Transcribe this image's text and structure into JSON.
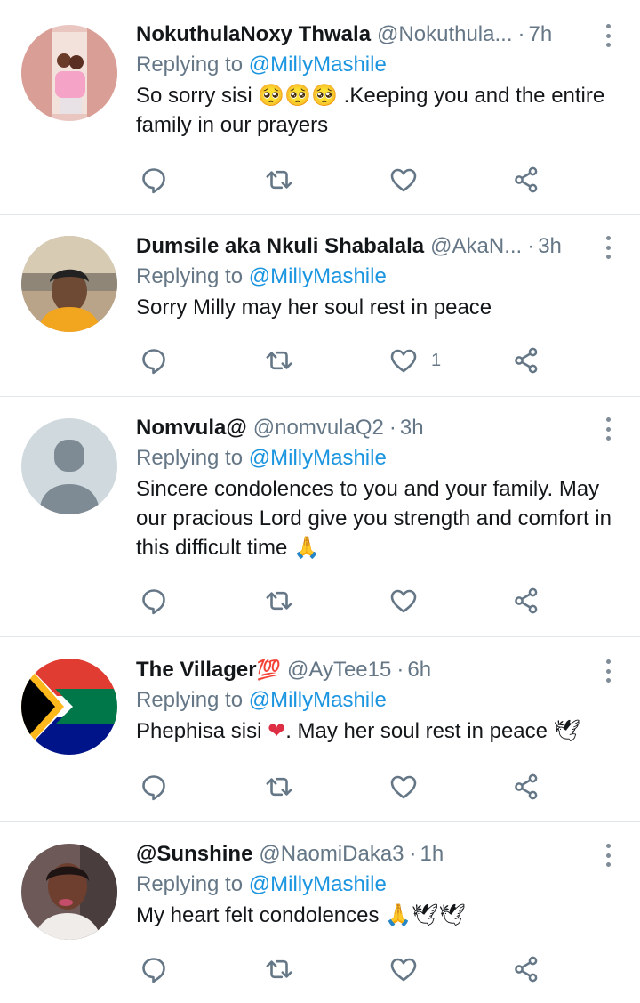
{
  "reply_label": "Replying to",
  "colors": {
    "name": "#14171a",
    "muted": "#657786",
    "mention": "#1b95e0",
    "divider": "#e1e6ea",
    "icon": "#657786"
  },
  "tweets": [
    {
      "name": "NokuthulaNoxy Thwala",
      "handle": "@Nokuthula...",
      "time": "7h",
      "reply_to": "@MillyMashile",
      "text": "So sorry sisi 🥺🥺🥺 .Keeping you and the entire family in our prayers",
      "likes": ""
    },
    {
      "name": "Dumsile aka Nkuli Shabalala",
      "handle": "@AkaN...",
      "time": "3h",
      "reply_to": "@MillyMashile",
      "text": "Sorry Milly may her soul rest in peace",
      "likes": "1"
    },
    {
      "name": "Nomvula@",
      "handle": "@nomvulaQ2",
      "time": "3h",
      "reply_to": "@MillyMashile",
      "text": "Sincere condolences to you and your family. May our pracious Lord give you strength and comfort in this difficult time 🙏",
      "likes": ""
    },
    {
      "name": "The Villager",
      "name_emoji": "💯",
      "handle": "@AyTee15",
      "time": "6h",
      "reply_to": "@MillyMashile",
      "text_before": "Phephisa sisi ",
      "text_heart": "❤",
      "text_after": ". May her soul rest in peace 🕊",
      "likes": ""
    },
    {
      "name": "@Sunshine",
      "handle": "@NaomiDaka3",
      "time": "1h",
      "reply_to": "@MillyMashile",
      "text": "My heart felt condolences 🙏🕊🕊",
      "likes": ""
    }
  ]
}
